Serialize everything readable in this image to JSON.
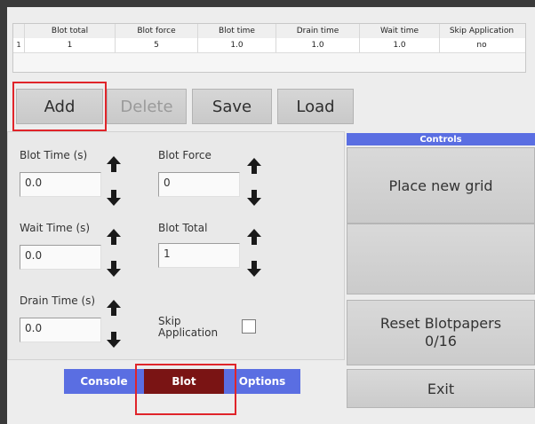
{
  "table": {
    "headers": [
      "Blot total",
      "Blot force",
      "Blot time",
      "Drain time",
      "Wait time",
      "Skip Application"
    ],
    "rows": [
      {
        "index": "1",
        "cells": [
          "1",
          "5",
          "1.0",
          "1.0",
          "1.0",
          "no"
        ]
      }
    ]
  },
  "toolbar": {
    "add_label": "Add",
    "delete_label": "Delete",
    "save_label": "Save",
    "load_label": "Load"
  },
  "params": {
    "blot_time": {
      "label": "Blot Time (s)",
      "value": "0.0"
    },
    "blot_force": {
      "label": "Blot Force",
      "value": "0"
    },
    "wait_time": {
      "label": "Wait Time (s)",
      "value": "0.0"
    },
    "blot_total": {
      "label": "Blot Total",
      "value": "1"
    },
    "drain_time": {
      "label": "Drain Time (s)",
      "value": "0.0"
    },
    "skip_application": {
      "label_line1": "Skip",
      "label_line2": "Application",
      "checked": false
    }
  },
  "tabs": {
    "console": "Console",
    "blot": "Blot",
    "options": "Options"
  },
  "controls": {
    "header": "Controls",
    "place_new_grid": "Place new grid",
    "reset_line1": "Reset Blotpapers",
    "reset_line2": "0/16",
    "exit": "Exit"
  },
  "colors": {
    "tab_blue": "#5a6ee2",
    "tab_active": "#7a1414",
    "highlight": "#e0242a"
  }
}
